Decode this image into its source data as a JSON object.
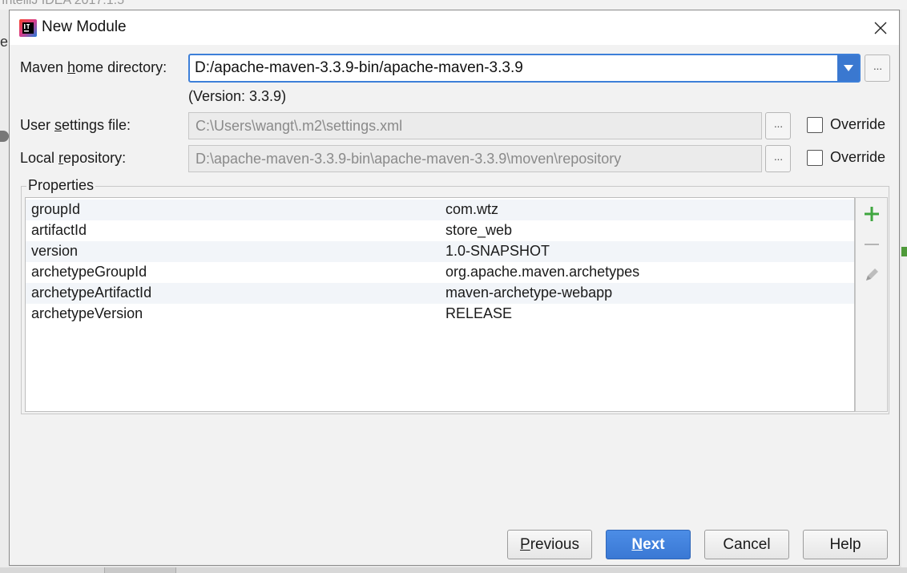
{
  "window": {
    "title": "New Module"
  },
  "background": {
    "ide_title": "IntelliJ IDEA 2017.1.5",
    "ide_left_char": "e"
  },
  "maven_home": {
    "label_pre": "Maven ",
    "label_key": "h",
    "label_post": "ome directory:",
    "value": "D:/apache-maven-3.3.9-bin/apache-maven-3.3.9",
    "version_text": "(Version: 3.3.9)"
  },
  "user_settings": {
    "label_pre": "User ",
    "label_key": "s",
    "label_post": "ettings file:",
    "value": "C:\\Users\\wangt\\.m2\\settings.xml",
    "override_label": "Override",
    "override_checked": false
  },
  "local_repo": {
    "label_pre": "Local ",
    "label_key": "r",
    "label_post": "epository:",
    "value": "D:\\apache-maven-3.3.9-bin\\apache-maven-3.3.9\\moven\\repository",
    "override_label": "Override",
    "override_checked": false
  },
  "browse_label": "···",
  "properties": {
    "title": "Properties",
    "rows": [
      {
        "key": "groupId",
        "value": "com.wtz"
      },
      {
        "key": "artifactId",
        "value": "store_web"
      },
      {
        "key": "version",
        "value": "1.0-SNAPSHOT"
      },
      {
        "key": "archetypeGroupId",
        "value": "org.apache.maven.archetypes"
      },
      {
        "key": "archetypeArtifactId",
        "value": "maven-archetype-webapp"
      },
      {
        "key": "archetypeVersion",
        "value": "RELEASE"
      }
    ],
    "toolbar": {
      "add_icon": "plus-icon",
      "remove_icon": "minus-icon",
      "edit_icon": "pencil-icon",
      "add_color": "#3fa63f"
    }
  },
  "buttons": {
    "previous": {
      "key": "P",
      "rest": "revious"
    },
    "next": {
      "key": "N",
      "rest": "ext"
    },
    "cancel": "Cancel",
    "help": "Help"
  },
  "colors": {
    "accent": "#3a78d4",
    "focus_border": "#3d7fd8"
  }
}
